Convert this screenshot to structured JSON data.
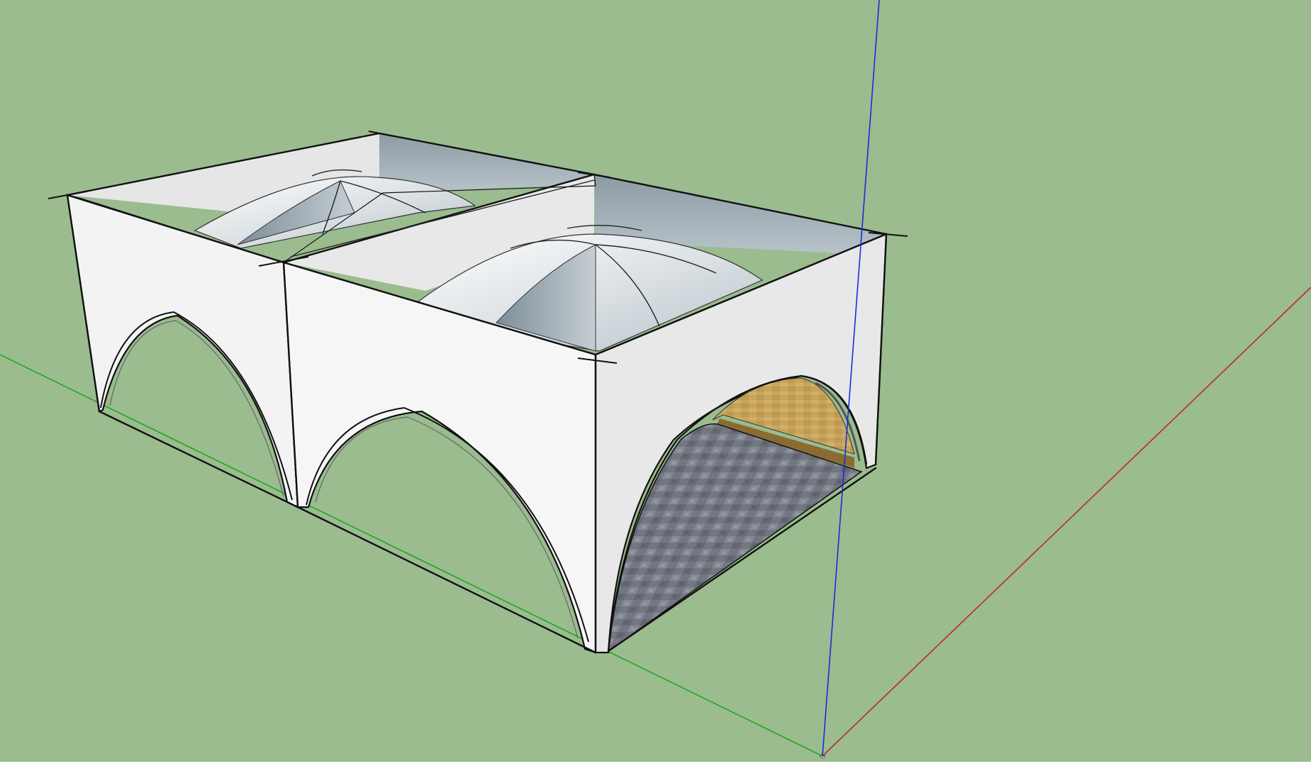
{
  "app": {
    "description_visible_text": []
  },
  "viewport": {
    "background_color": "#9abc8f",
    "status_strip_color": "#ffffff"
  },
  "axes": {
    "red_axis": {
      "color": "#c0272d"
    },
    "green_axis": {
      "color": "#1fa81f"
    },
    "blue_axis": {
      "color": "#1d2bd9"
    }
  },
  "model": {
    "wall_colors": {
      "lit": "#f6f6f6",
      "shaded": "#e2e2e2",
      "inner_shadow": "#9aa6ad",
      "dome_shadow": "#8f9ea8",
      "wood_texture": "#c7a45a",
      "floor_texture": "#6f737d"
    },
    "bays": 2
  }
}
